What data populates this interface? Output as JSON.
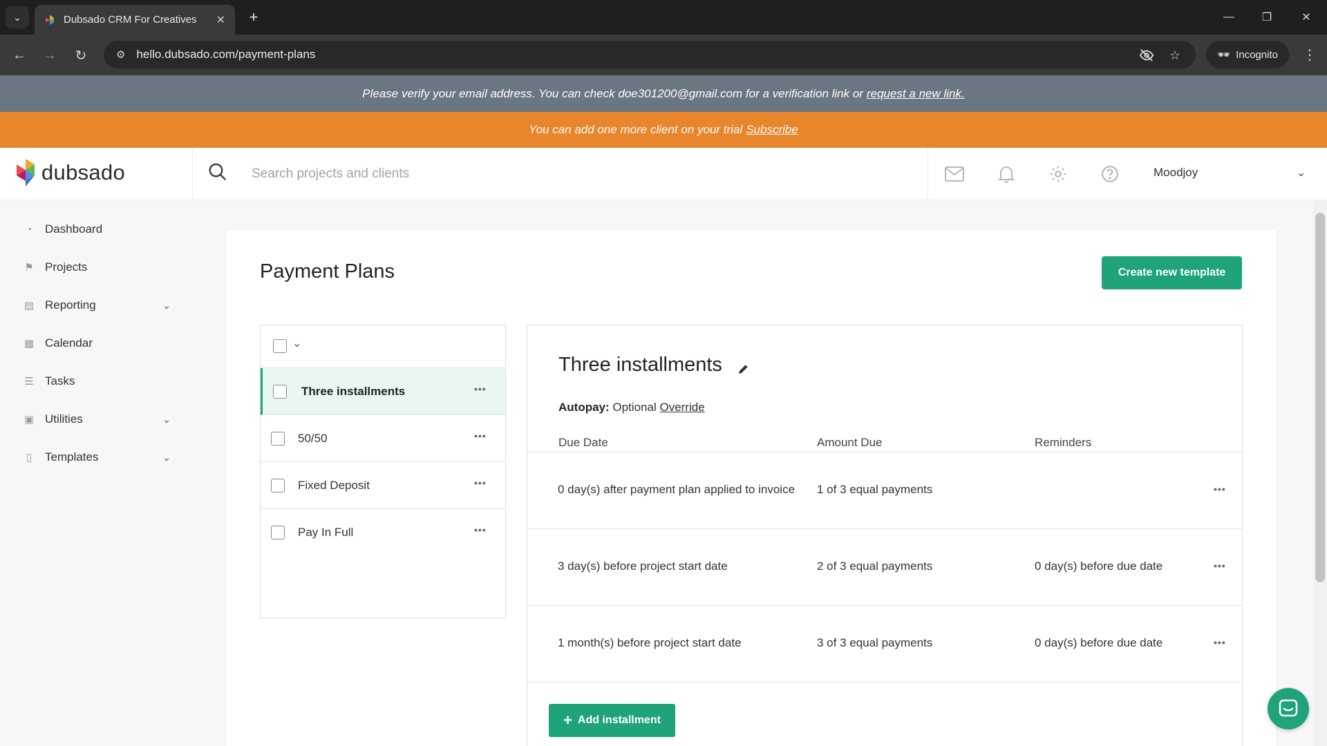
{
  "browser": {
    "tab_title": "Dubsado CRM For Creatives",
    "url": "hello.dubsado.com/payment-plans",
    "incognito_label": "Incognito"
  },
  "banners": {
    "verify_text": "Please verify your email address. You can check doe301200@gmail.com for a verification link or",
    "verify_link": "request a new link.",
    "trial_text": "You can add one more client on your trial",
    "trial_link": "Subscribe"
  },
  "header": {
    "logo_text": "dubsado",
    "search_placeholder": "Search projects and clients",
    "user_name": "Moodjoy"
  },
  "sidebar": {
    "items": [
      {
        "label": "Dashboard",
        "icon": "dashboard-icon"
      },
      {
        "label": "Projects",
        "icon": "projects-icon"
      },
      {
        "label": "Reporting",
        "icon": "reporting-icon",
        "expandable": true
      },
      {
        "label": "Calendar",
        "icon": "calendar-icon"
      },
      {
        "label": "Tasks",
        "icon": "tasks-icon"
      },
      {
        "label": "Utilities",
        "icon": "utilities-icon",
        "expandable": true
      },
      {
        "label": "Templates",
        "icon": "templates-icon",
        "expandable": true
      }
    ]
  },
  "main": {
    "title": "Payment Plans",
    "create_button": "Create new template",
    "plans": [
      {
        "name": "Three installments",
        "selected": true
      },
      {
        "name": "50/50",
        "selected": false
      },
      {
        "name": "Fixed Deposit",
        "selected": false
      },
      {
        "name": "Pay In Full",
        "selected": false
      }
    ],
    "detail": {
      "title": "Three installments",
      "autopay_label": "Autopay:",
      "autopay_value": "Optional",
      "override_link": "Override",
      "columns": [
        "Due Date",
        "Amount Due",
        "Reminders"
      ],
      "rows": [
        {
          "due": "0 day(s) after payment plan applied to invoice",
          "amount": "1 of 3 equal payments",
          "reminder": ""
        },
        {
          "due": "3 day(s) before project start date",
          "amount": "2 of 3 equal payments",
          "reminder": "0 day(s) before due date"
        },
        {
          "due": "1 month(s) before project start date",
          "amount": "3 of 3 equal payments",
          "reminder": "0 day(s) before due date"
        }
      ],
      "add_button": "Add installment"
    }
  },
  "colors": {
    "accent": "#1ea37a",
    "trial_banner": "#e9852b",
    "verify_banner": "#6b7683"
  }
}
